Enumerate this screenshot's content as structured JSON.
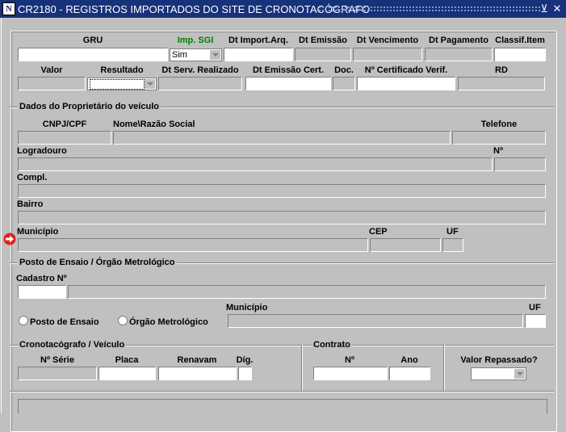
{
  "window": {
    "title": "CR2180 - REGISTROS IMPORTADOS DO SITE DE CRONOTACÓGRAFO",
    "app_icon": "N",
    "minimize_glyph": "⊻",
    "close_glyph": "✕"
  },
  "row1": {
    "gru": "GRU",
    "imp_sgi": "Imp. SGI",
    "imp_sgi_value": "Sim",
    "dt_import": "Dt Import.Arq.",
    "dt_emissao": "Dt Emissão",
    "dt_vencimento": "Dt Vencimento",
    "dt_pagamento": "Dt Pagamento",
    "classif_item": "Classif.Item"
  },
  "row2": {
    "valor": "Valor",
    "resultado": "Resultado",
    "dt_serv": "Dt Serv. Realizado",
    "dt_emissao_cert": "Dt Emissão Cert.",
    "doc": "Doc.",
    "n_certificado": "Nº Certificado Verif.",
    "rd": "RD"
  },
  "proprietario": {
    "section": "Dados do Proprietário do veículo",
    "cnpj": "CNPJ/CPF",
    "nome": "Nome\\Razão Social",
    "telefone": "Telefone",
    "logradouro": "Logradouro",
    "numero": "Nº",
    "compl": "Compl.",
    "bairro": "Bairro",
    "municipio": "Município",
    "cep": "CEP",
    "uf": "UF"
  },
  "posto": {
    "section": "Posto de Ensaio / Órgão Metrológico",
    "cadastro": "Cadastro Nº",
    "radio_posto": "Posto de Ensaio",
    "radio_orgao": "Órgão Metrológico",
    "municipio": "Município",
    "uf": "UF"
  },
  "crono": {
    "section": "Cronotacógrafo / Veículo",
    "n_serie": "Nº Série",
    "placa": "Placa",
    "renavam": "Renavam",
    "dig": "Díg."
  },
  "contrato": {
    "section": "Contrato",
    "numero": "Nº",
    "ano": "Ano"
  },
  "repasse": {
    "label": "Valor Repassado?"
  },
  "colors": {
    "titlebar": "#17317a",
    "background": "#c0c0c0",
    "green_label": "#008000",
    "marker": "#e02020"
  }
}
